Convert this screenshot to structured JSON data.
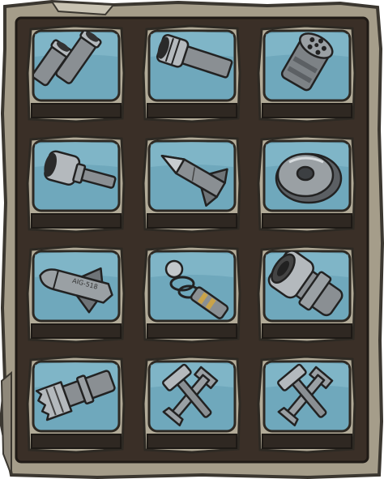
{
  "panel": {
    "title": ""
  },
  "colors": {
    "frame_stone": "#a59d8a",
    "frame_edge": "#3b3730",
    "inner_board": "#3a2f27",
    "tile_stone": "#b2ab98",
    "screen_blue": "#6fa8bc",
    "label_bar": "#2f2822",
    "metal": "#8a8f93"
  },
  "slots": [
    {
      "id": "twin-cannon",
      "icon": "twin-cannon-icon",
      "label": ""
    },
    {
      "id": "heavy-cannon",
      "icon": "heavy-cannon-icon",
      "label": ""
    },
    {
      "id": "gatling-gun",
      "icon": "gatling-gun-icon",
      "label": ""
    },
    {
      "id": "short-cannon",
      "icon": "short-cannon-icon",
      "label": ""
    },
    {
      "id": "rocket",
      "icon": "rocket-icon",
      "label": ""
    },
    {
      "id": "mine",
      "icon": "mine-icon",
      "label": ""
    },
    {
      "id": "missile",
      "icon": "missile-icon",
      "label": "",
      "icon_text": "AIG-518"
    },
    {
      "id": "tesla-coil",
      "icon": "tesla-coil-icon",
      "label": ""
    },
    {
      "id": "plasma-cannon",
      "icon": "plasma-cannon-icon",
      "label": ""
    },
    {
      "id": "laser-barrel",
      "icon": "laser-barrel-icon",
      "label": ""
    },
    {
      "id": "locked-1",
      "icon": "wrench-hammer-icon",
      "label": ""
    },
    {
      "id": "locked-2",
      "icon": "wrench-hammer-icon",
      "label": ""
    }
  ]
}
